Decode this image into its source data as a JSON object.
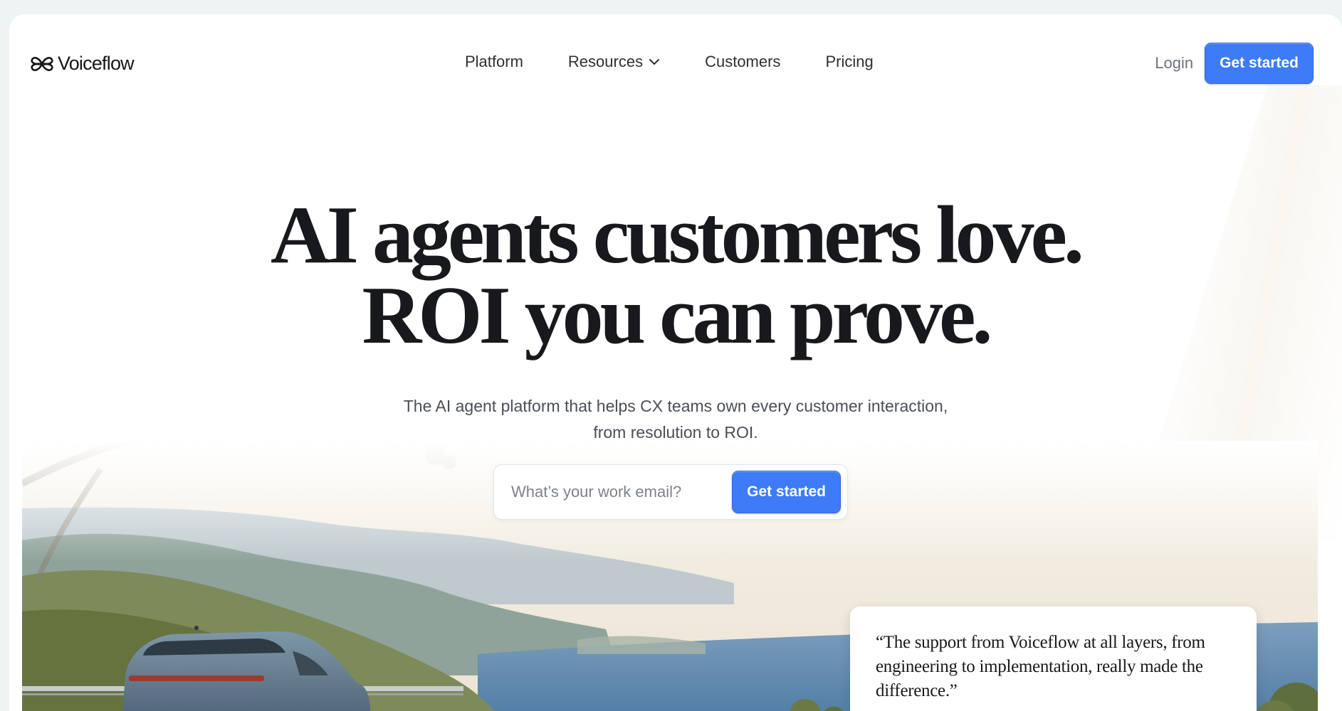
{
  "brand": {
    "name": "Voiceflow",
    "accent": "#3d7cf6",
    "logo_icon": "voiceflow-logo-icon"
  },
  "nav": {
    "links": [
      {
        "label": "Platform",
        "has_dropdown": false
      },
      {
        "label": "Resources",
        "has_dropdown": true,
        "icon": "chevron-down-icon"
      },
      {
        "label": "Customers",
        "has_dropdown": false
      },
      {
        "label": "Pricing",
        "has_dropdown": false
      }
    ],
    "login_label": "Login",
    "cta_label": "Get started"
  },
  "hero": {
    "title_line1": "AI agents customers love.",
    "title_line2": "ROI you can prove.",
    "subtitle_line1": "The AI agent platform that helps CX teams own every customer interaction,",
    "subtitle_line2": "from resolution to ROI."
  },
  "email_form": {
    "placeholder": "What’s your work email?",
    "value": "",
    "button_label": "Get started"
  },
  "testimonial": {
    "quote": "“The support from Voiceflow at all layers, from engineering to implementation, really made the difference.”"
  }
}
